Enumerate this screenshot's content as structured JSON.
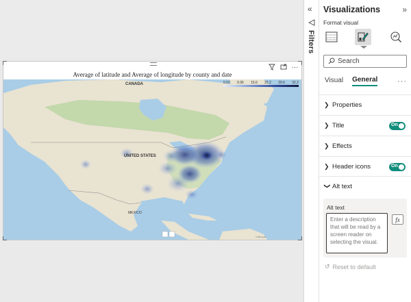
{
  "visual": {
    "title": "Average of latitude and Average of longitude by county and date",
    "legend_ticks": [
      "0.02",
      "9.95",
      "15.6",
      "22.2",
      "29.6",
      "32.2"
    ],
    "map_labels": {
      "canada": "CANADA",
      "united_states": "UNITED STATES",
      "mexico": "MEXICO"
    },
    "header_icons": [
      "filter-icon",
      "focus-mode-icon",
      "more-options-icon"
    ],
    "heatmap_colors": [
      "#9db4df",
      "#5573bd",
      "#2a3d8a"
    ]
  },
  "filters": {
    "label": "Filters"
  },
  "viz_pane": {
    "title": "Visualizations",
    "subtitle": "Format visual",
    "search_placeholder": "Search",
    "tabs": [
      {
        "label": "Visual",
        "active": false
      },
      {
        "label": "General",
        "active": true
      }
    ],
    "sections": [
      {
        "label": "Properties",
        "expanded": false
      },
      {
        "label": "Title",
        "expanded": false,
        "toggle": "On"
      },
      {
        "label": "Effects",
        "expanded": false
      },
      {
        "label": "Header icons",
        "expanded": false,
        "toggle": "On"
      },
      {
        "label": "Alt text",
        "expanded": true
      }
    ],
    "alt_text": {
      "label": "Alt text",
      "placeholder": "Enter a description that will be read by a screen reader on selecting the visual.",
      "fx_label": "fx"
    },
    "reset_label": "Reset to default",
    "accent": "#118d7c"
  }
}
